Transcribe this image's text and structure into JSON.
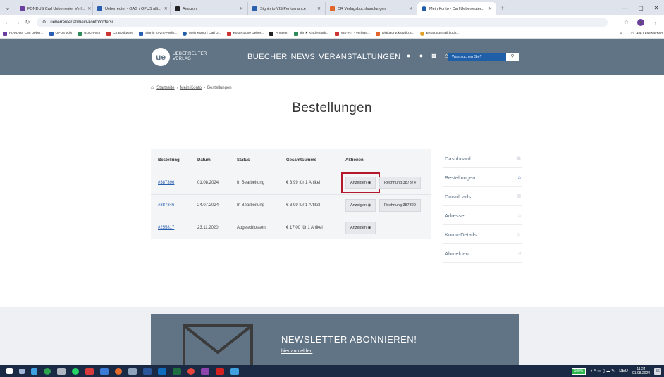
{
  "browser": {
    "tabs": [
      {
        "label": "FONDUS Carl Ueberreuter Verl...",
        "color": "#6b3fa0",
        "active": false
      },
      {
        "label": "Ueberreuter - OAG / OPUS allt...",
        "color": "#2a5fb0",
        "active": false
      },
      {
        "label": "Amazon",
        "color": "#222222",
        "active": false
      },
      {
        "label": "Signin to VIS Performance",
        "color": "#2a5fb0",
        "active": false
      },
      {
        "label": "CR Verlagsbuchhandlungen",
        "color": "#e0662a",
        "active": false
      },
      {
        "label": "Mein Konto - Carl Ueberreuter...",
        "color": "#1f5fa8",
        "active": true
      }
    ],
    "url": "ueberreuter.at/mein-konto/orders/",
    "bookmarks": [
      {
        "label": "FONDUS Carl Ueber...",
        "color": "#6b3fa0"
      },
      {
        "label": "OPUS edls",
        "color": "#2a5fb0"
      },
      {
        "label": "BUCHAGT",
        "color": "#2e8b57"
      },
      {
        "label": "CS Bookware",
        "color": "#c33"
      },
      {
        "label": "Signin to VIS-Perfo...",
        "color": "#2a5fb0"
      },
      {
        "label": "Mein Konto | Carl U...",
        "color": "#1f5fa8"
      },
      {
        "label": "Kostenzone Ueber...",
        "color": "#c33"
      },
      {
        "label": "Amazon",
        "color": "#222222"
      },
      {
        "label": "Ihr ★ Kinderstadt...",
        "color": "#2e8b57"
      },
      {
        "label": "VIS-INT - Verlage...",
        "color": "#c33"
      },
      {
        "label": "Digitaldruckstudio.s...",
        "color": "#e0662a"
      },
      {
        "label": "Beratungsmail buch...",
        "color": "#e0a12a"
      }
    ],
    "bookmarks_more": "»",
    "bookmarks_all": "Alle Lesezeichen"
  },
  "site": {
    "logo_mark": "ue",
    "logo_line1": "UEBERREUTER",
    "logo_line2": "VERLAG",
    "nav": [
      "BUECHER",
      "NEWS",
      "VERANSTALTUNGEN"
    ],
    "search_placeholder": "Was suchen Sie?"
  },
  "breadcrumb": {
    "home": "Startseite",
    "account": "Mein Konto",
    "current": "Bestellungen"
  },
  "page_title": "Bestellungen",
  "orders": {
    "headers": [
      "Bestellung",
      "Datum",
      "Status",
      "Gesamtsumme",
      "Aktionen"
    ],
    "rows": [
      {
        "id": "#387396",
        "date": "01.08.2024",
        "status": "In Bearbeitung",
        "total": "€ 3,99 für 1 Artikel",
        "view": "Anzeigen",
        "invoice": "Rechnung 387374"
      },
      {
        "id": "#387346",
        "date": "24.07.2024",
        "status": "In Bearbeitung",
        "total": "€ 3,99 für 1 Artikel",
        "view": "Anzeigen",
        "invoice": "Rechnung 387329"
      },
      {
        "id": "#255817",
        "date": "23.11.2020",
        "status": "Abgeschlossen",
        "total": "€ 17,00 für 1 Artikel",
        "view": "Anzeigen",
        "invoice": ""
      }
    ]
  },
  "account_nav": [
    {
      "label": "Dashboard",
      "icon": "dashboard-icon"
    },
    {
      "label": "Bestellungen",
      "icon": "basket-icon"
    },
    {
      "label": "Downloads",
      "icon": "file-icon"
    },
    {
      "label": "Adresse",
      "icon": "home-icon"
    },
    {
      "label": "Konto-Details",
      "icon": "user-icon"
    },
    {
      "label": "Abmelden",
      "icon": "logout-icon"
    }
  ],
  "newsletter": {
    "title": "NEWSLETTER ABONNIEREN!",
    "link": "hier anmelden"
  },
  "taskbar": {
    "battery": "100%",
    "lang": "DEU",
    "time": "11:24",
    "date": "01.08.2024",
    "notifications": "56"
  }
}
